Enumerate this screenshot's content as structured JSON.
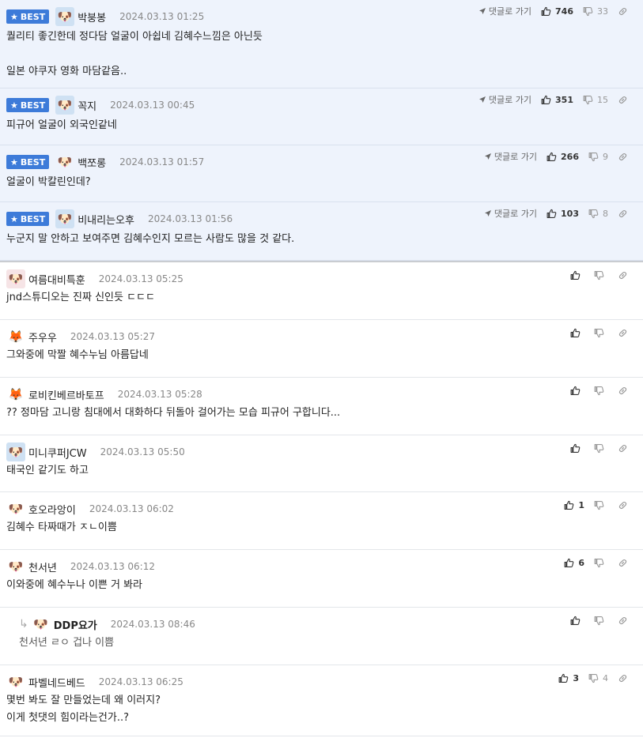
{
  "best_comments": [
    {
      "badge": "BEST",
      "nick": "박붕봉",
      "date": "2024.03.13 01:25",
      "body": "퀄리티 좋긴한데 정다담 얼굴이 아쉽네 김혜수느낌은 아닌듯\n\n일본 야쿠자 영화 마담같음..",
      "goto": "댓글로 가기",
      "likes": "746",
      "dislikes": "33",
      "avatar": "bluedog"
    },
    {
      "badge": "BEST",
      "nick": "꼭지",
      "date": "2024.03.13 00:45",
      "body": "피규어 얼굴이 외국인같네",
      "goto": "댓글로 가기",
      "likes": "351",
      "dislikes": "15",
      "avatar": "bluedog"
    },
    {
      "badge": "BEST",
      "nick": "백쪼롱",
      "date": "2024.03.13 01:57",
      "body": "얼굴이 박칼린인데?",
      "goto": "댓글로 가기",
      "likes": "266",
      "dislikes": "9",
      "avatar": "puppy"
    },
    {
      "badge": "BEST",
      "nick": "비내리는오후",
      "date": "2024.03.13 01:56",
      "body": "누군지 말 안하고 보여주면 김혜수인지 모르는 사람도 많을 것 같다.",
      "goto": "댓글로 가기",
      "likes": "103",
      "dislikes": "8",
      "avatar": "bluedog"
    }
  ],
  "comments": [
    {
      "nick": "여름대비특훈",
      "date": "2024.03.13 05:25",
      "body": "jnd스튜디오는 진짜 신인듯 ㄷㄷㄷ",
      "likes": "",
      "dislikes": "",
      "avatar": "pink"
    },
    {
      "nick": "주우우",
      "date": "2024.03.13 05:27",
      "body": "그와중에 막짤 혜수누님 아름답네",
      "likes": "",
      "dislikes": "",
      "avatar": "fox"
    },
    {
      "nick": "로비킨베르바토프",
      "date": "2024.03.13 05:28",
      "body": "?? 정마담 고니랑 침대에서 대화하다 뒤돌아 걸어가는 모습 피규어 구합니다...",
      "likes": "",
      "dislikes": "",
      "avatar": "fox"
    },
    {
      "nick": "미니쿠퍼JCW",
      "date": "2024.03.13 05:50",
      "body": "태국인 같기도 하고",
      "likes": "",
      "dislikes": "",
      "avatar": "bluedog"
    },
    {
      "nick": "호오라앙이",
      "date": "2024.03.13 06:02",
      "body": "김혜수 타짜때가 ㅈㄴ이쁨",
      "likes": "1",
      "dislikes": "",
      "avatar": "puppy"
    },
    {
      "nick": "천서년",
      "date": "2024.03.13 06:12",
      "body": "이와중에 혜수누나 이쁜 거 봐라",
      "likes": "6",
      "dislikes": "",
      "avatar": "puppy"
    },
    {
      "nick": "DDP요가",
      "date": "2024.03.13 08:46",
      "body": "천서년 ㄹㅇ 겁나 이쁨",
      "likes": "",
      "dislikes": "",
      "avatar": "puppy",
      "reply": true
    },
    {
      "nick": "파벨네드베드",
      "date": "2024.03.13 06:25",
      "body": "몇번 봐도 잘 만들었는데 왜 이러지?\n이게 첫댓의 힘이라는건가..?",
      "likes": "3",
      "dislikes": "4",
      "avatar": "puppy"
    }
  ]
}
